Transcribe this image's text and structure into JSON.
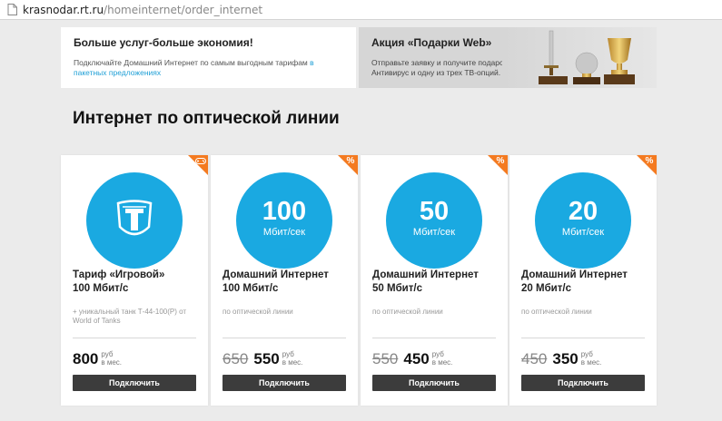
{
  "address_bar": {
    "host": "krasnodar.rt.ru",
    "path": "/homeinternet/order_internet"
  },
  "promos": [
    {
      "title": "Больше услуг-больше экономия!",
      "text": "Подключайте Домашний Интернет по самым выгодным тарифам ",
      "link": "в пакетных предложениях"
    },
    {
      "title": "Акция «Подарки Web»",
      "text": "Отправьте заявку и получите подарок: Антивирус и одну из трех ТВ-опций."
    }
  ],
  "section_title": "Интернет по оптической линии",
  "accent_color": "#1aa9e1",
  "corner_color": "#f47a20",
  "cards": [
    {
      "badge_icon": "gamepad-icon",
      "circle_icon": "world-of-tanks-logo",
      "name_line1": "Тариф «Игровой»",
      "name_line2": "100 Мбит/с",
      "description": "+ уникальный танк Т-44-100(Р) от World of Tanks",
      "old_price": "",
      "price": "800",
      "unit_line1": "руб",
      "unit_line2": "в мес.",
      "button": "Подключить"
    },
    {
      "badge_icon": "percent-icon",
      "badge": "%",
      "speed": "100",
      "speed_unit": "Мбит/сек",
      "name_line1": "Домашний Интернет",
      "name_line2": "100 Мбит/с",
      "description": "по оптической линии",
      "old_price": "650",
      "price": "550",
      "unit_line1": "руб",
      "unit_line2": "в мес.",
      "button": "Подключить"
    },
    {
      "badge_icon": "percent-icon",
      "badge": "%",
      "speed": "50",
      "speed_unit": "Мбит/сек",
      "name_line1": "Домашний Интернет",
      "name_line2": "50 Мбит/с",
      "description": "по оптической линии",
      "old_price": "550",
      "price": "450",
      "unit_line1": "руб",
      "unit_line2": "в мес.",
      "button": "Подключить"
    },
    {
      "badge_icon": "percent-icon",
      "badge": "%",
      "speed": "20",
      "speed_unit": "Мбит/сек",
      "name_line1": "Домашний Интернет",
      "name_line2": "20 Мбит/с",
      "description": "по оптической линии",
      "old_price": "450",
      "price": "350",
      "unit_line1": "руб",
      "unit_line2": "в мес.",
      "button": "Подключить"
    }
  ]
}
